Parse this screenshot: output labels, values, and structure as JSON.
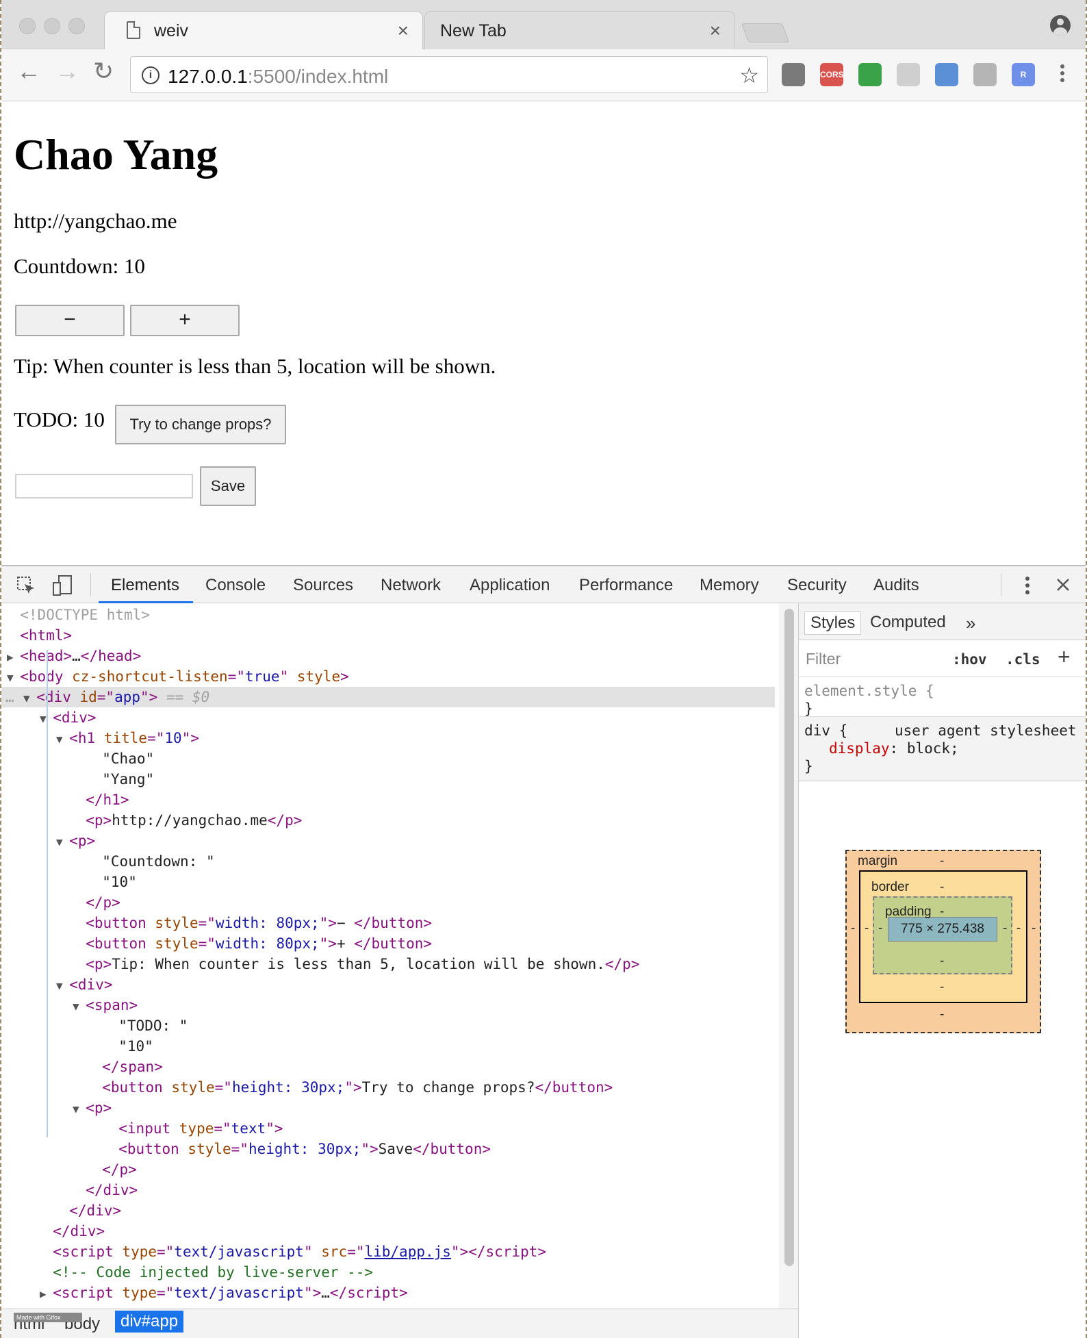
{
  "browser": {
    "tabs": [
      {
        "title": "weiv",
        "active": true
      },
      {
        "title": "New Tab",
        "active": false
      }
    ],
    "tab_close_glyph": "×",
    "url_host": "127.0.0.1",
    "url_rest": ":5500/index.html",
    "extensions": [
      {
        "name": "recycle-extension-icon",
        "label": "",
        "color": "#7a7a7a"
      },
      {
        "name": "cors-extension-icon",
        "label": "CORS",
        "color": "#d9534f"
      },
      {
        "name": "clover-extension-icon",
        "label": "",
        "color": "#3aa34a"
      },
      {
        "name": "react-extension-icon",
        "label": "",
        "color": "#cfcfcf"
      },
      {
        "name": "eyedropper-extension-icon",
        "label": "",
        "color": "#5b8fd6"
      },
      {
        "name": "vue-extension-icon",
        "label": "",
        "color": "#b5b5b5"
      },
      {
        "name": "redux-extension-icon",
        "label": "R",
        "color": "#6f8fe8"
      }
    ]
  },
  "page": {
    "heading": "Chao Yang",
    "link_text": "http://yangchao.me",
    "countdown_text": "Countdown: 10",
    "minus_label": "−",
    "plus_label": "+",
    "tip": "Tip: When counter is less than 5, location will be shown.",
    "todo_text": "TODO: 10",
    "change_props_label": "Try to change props?",
    "input_value": "",
    "save_label": "Save"
  },
  "devtools": {
    "tabs": [
      "Elements",
      "Console",
      "Sources",
      "Network",
      "Application",
      "Performance",
      "Memory",
      "Security",
      "Audits"
    ],
    "active_tab": "Elements",
    "dom_lines": [
      {
        "indent": 0,
        "tri": "",
        "html": "<span class='gy'>&lt;!DOCTYPE html&gt;</span>"
      },
      {
        "indent": 0,
        "tri": "",
        "html": "<span class='tg'>&lt;html&gt;</span>"
      },
      {
        "indent": 0,
        "tri": "▶",
        "html": "<span class='tg'>&lt;head&gt;</span><span class='tx'>…</span><span class='tg'>&lt;/head&gt;</span>"
      },
      {
        "indent": 0,
        "tri": "▼",
        "html": "<span class='tg'>&lt;body </span><span class='at'>cz-shortcut-listen</span><span class='tg'>=\"</span><span class='av'>true</span><span class='tg'>\" </span><span class='at'>style</span><span class='tg'>&gt;</span>"
      },
      {
        "indent": 1,
        "tri": "▼",
        "html": "<span class='tg'>&lt;div </span><span class='at'>id</span><span class='tg'>=\"</span><span class='av'>app</span><span class='tg'>\"&gt;</span><span class='gy'> == </span><span class='gy' style='font-style:italic'>$0</span>",
        "selected": true
      },
      {
        "indent": 2,
        "tri": "▼",
        "html": "<span class='tg'>&lt;div&gt;</span>"
      },
      {
        "indent": 3,
        "tri": "▼",
        "html": "<span class='tg'>&lt;h1 </span><span class='at'>title</span><span class='tg'>=\"</span><span class='av'>10</span><span class='tg'>\"&gt;</span>"
      },
      {
        "indent": 5,
        "tri": "",
        "html": "<span class='tx'>\"Chao\"</span>"
      },
      {
        "indent": 5,
        "tri": "",
        "html": "<span class='tx'>\"Yang\"</span>"
      },
      {
        "indent": 4,
        "tri": "",
        "html": "<span class='tg'>&lt;/h1&gt;</span>"
      },
      {
        "indent": 4,
        "tri": "",
        "html": "<span class='tg'>&lt;p&gt;</span><span class='tx'>http://yangchao.me</span><span class='tg'>&lt;/p&gt;</span>"
      },
      {
        "indent": 3,
        "tri": "▼",
        "html": "<span class='tg'>&lt;p&gt;</span>"
      },
      {
        "indent": 5,
        "tri": "",
        "html": "<span class='tx'>\"Countdown: \"</span>"
      },
      {
        "indent": 5,
        "tri": "",
        "html": "<span class='tx'>\"10\"</span>"
      },
      {
        "indent": 4,
        "tri": "",
        "html": "<span class='tg'>&lt;/p&gt;</span>"
      },
      {
        "indent": 4,
        "tri": "",
        "html": "<span class='tg'>&lt;button </span><span class='at'>style</span><span class='tg'>=\"</span><span class='av'>width: 80px;</span><span class='tg'>\"&gt;</span><span class='tx'>− </span><span class='tg'>&lt;/button&gt;</span>"
      },
      {
        "indent": 4,
        "tri": "",
        "html": "<span class='tg'>&lt;button </span><span class='at'>style</span><span class='tg'>=\"</span><span class='av'>width: 80px;</span><span class='tg'>\"&gt;</span><span class='tx'>+ </span><span class='tg'>&lt;/button&gt;</span>"
      },
      {
        "indent": 4,
        "tri": "",
        "html": "<span class='tg'>&lt;p&gt;</span><span class='tx'>Tip: When counter is less than 5, location will be shown.</span><span class='tg'>&lt;/p&gt;</span>"
      },
      {
        "indent": 3,
        "tri": "▼",
        "html": "<span class='tg'>&lt;div&gt;</span>"
      },
      {
        "indent": 4,
        "tri": "▼",
        "html": "<span class='tg'>&lt;span&gt;</span>"
      },
      {
        "indent": 6,
        "tri": "",
        "html": "<span class='tx'>\"TODO: \"</span>"
      },
      {
        "indent": 6,
        "tri": "",
        "html": "<span class='tx'>\"10\"</span>"
      },
      {
        "indent": 5,
        "tri": "",
        "html": "<span class='tg'>&lt;/span&gt;</span>"
      },
      {
        "indent": 5,
        "tri": "",
        "html": "<span class='tg'>&lt;button </span><span class='at'>style</span><span class='tg'>=\"</span><span class='av'>height: 30px;</span><span class='tg'>\"&gt;</span><span class='tx'>Try to change props?</span><span class='tg'>&lt;/button&gt;</span>"
      },
      {
        "indent": 4,
        "tri": "▼",
        "html": "<span class='tg'>&lt;p&gt;</span>"
      },
      {
        "indent": 6,
        "tri": "",
        "html": "<span class='tg'>&lt;input </span><span class='at'>type</span><span class='tg'>=\"</span><span class='av'>text</span><span class='tg'>\"&gt;</span>"
      },
      {
        "indent": 6,
        "tri": "",
        "html": "<span class='tg'>&lt;button </span><span class='at'>style</span><span class='tg'>=\"</span><span class='av'>height: 30px;</span><span class='tg'>\"&gt;</span><span class='tx'>Save</span><span class='tg'>&lt;/button&gt;</span>"
      },
      {
        "indent": 5,
        "tri": "",
        "html": "<span class='tg'>&lt;/p&gt;</span>"
      },
      {
        "indent": 4,
        "tri": "",
        "html": "<span class='tg'>&lt;/div&gt;</span>"
      },
      {
        "indent": 3,
        "tri": "",
        "html": "<span class='tg'>&lt;/div&gt;</span>"
      },
      {
        "indent": 2,
        "tri": "",
        "html": "<span class='tg'>&lt;/div&gt;</span>"
      },
      {
        "indent": 2,
        "tri": "",
        "html": "<span class='tg'>&lt;script </span><span class='at'>type</span><span class='tg'>=\"</span><span class='av'>text/javascript</span><span class='tg'>\" </span><span class='at'>src</span><span class='tg'>=\"</span><span class='ln'>lib/app.js</span><span class='tg'>\"&gt;&lt;/script&gt;</span>"
      },
      {
        "indent": 2,
        "tri": "",
        "html": "<span class='cm'>&lt;!-- Code injected by live-server --&gt;</span>"
      },
      {
        "indent": 2,
        "tri": "▶",
        "html": "<span class='tg'>&lt;script </span><span class='at'>type</span><span class='tg'>=\"</span><span class='av'>text/javascript</span><span class='tg'>\"&gt;</span><span class='tx'>…</span><span class='tg'>&lt;/script&gt;</span>"
      }
    ],
    "styles_tabs": [
      "Styles",
      "Computed"
    ],
    "more_glyph": "»",
    "filter_placeholder": "Filter",
    "hov_label": ":hov",
    "cls_label": ".cls",
    "add_rule_glyph": "+",
    "element_style_selector": "element.style {",
    "close_brace": "}",
    "div_selector": "div {",
    "ua_label": "user agent stylesheet",
    "display_prop": "display",
    "display_value": "block;",
    "box": {
      "margin_label": "margin",
      "border_label": "border",
      "padding_label": "padding",
      "dash": "-",
      "content_size": "775 × 275.438"
    },
    "breadcrumbs": [
      "html",
      "body",
      "div#app"
    ],
    "gifox_text": "Made with Gifox"
  }
}
